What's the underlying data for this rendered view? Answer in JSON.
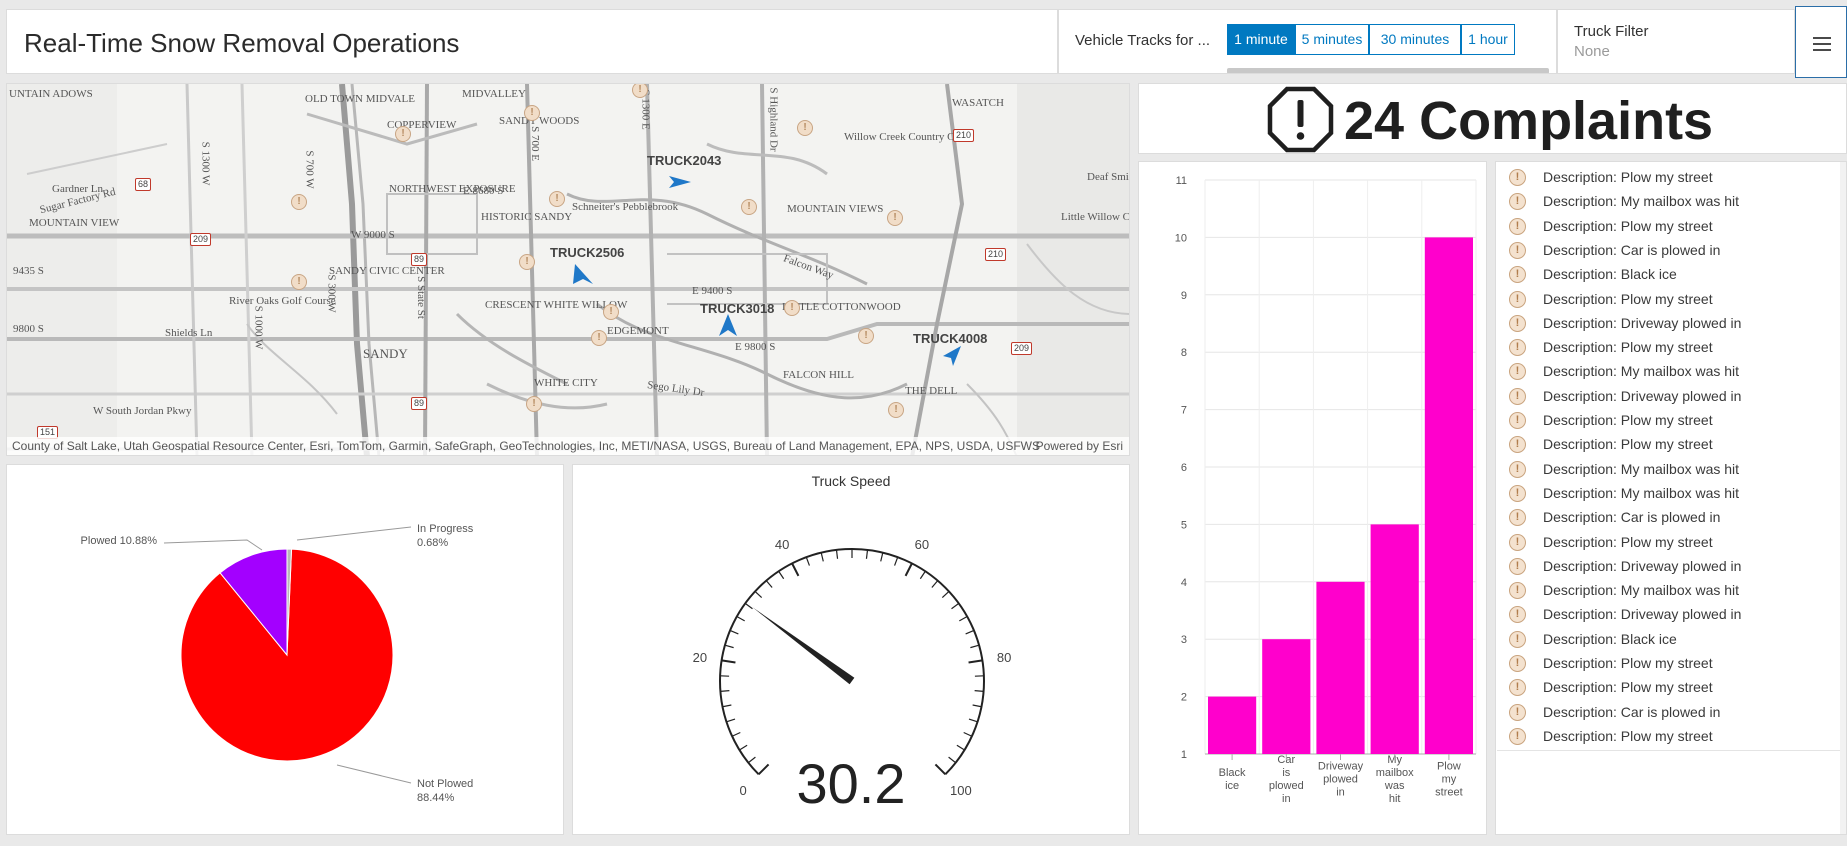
{
  "header": {
    "title": "Real-Time Snow Removal Operations",
    "tracks_label": "Vehicle Tracks for ...",
    "track_options": [
      "1 minute",
      "5 minutes",
      "30 minutes",
      "1 hour"
    ],
    "selected_track": "1 minute",
    "truck_filter_label": "Truck Filter",
    "truck_filter_value": "None",
    "menu_icon": "hamburger-menu-icon"
  },
  "map": {
    "attribution": "County of Salt Lake, Utah Geospatial Resource Center, Esri, TomTom, Garmin, SafeGraph, GeoTechnologies, Inc, METI/NASA, USGS, Bureau of Land Management, EPA, NPS, USDA, USFWS",
    "powered_by": "Powered by Esri",
    "trucks": [
      "TRUCK2043",
      "TRUCK2506",
      "TRUCK3018",
      "TRUCK4008"
    ],
    "place_labels": [
      "UNTAIN ADOWS",
      "OLD TOWN MIDVALE",
      "MIDVALLEY",
      "COPPERVIEW",
      "SANDY WOODS",
      "WASATCH",
      "Sugar Factory Rd",
      "Gardner Ln",
      "NORTHWEST EXPOSURE",
      "E 8680 S",
      "Schneiter's Pebblebrook",
      "Willow Creek Country Club",
      "Deaf Smi",
      "MOUNTAIN VIEW",
      "HISTORIC SANDY",
      "MOUNTAIN VIEWS",
      "Little Willow C",
      "W 9000 S",
      "SANDY CIVIC CENTER",
      "Falcon Way",
      "9435 S",
      "River Oaks Golf Course",
      "CRESCENT WHITE WILLOW",
      "E 9400 S",
      "LITTLE COTTONWOOD",
      "9800 S",
      "EDGEMONT",
      "E 9800 S",
      "Shields Ln",
      "SANDY",
      "FALCON HILL",
      "WHITE CITY",
      "Sego Lily Dr",
      "THE DELL",
      "W South Jordan Pkwy",
      "S 1300 W",
      "S 700 W",
      "S 1000 W",
      "S 300 W",
      "S State St",
      "S 700 E",
      "S 1300 E",
      "S Highland Dr"
    ],
    "shields": [
      "68",
      "209",
      "89",
      "210",
      "210",
      "89",
      "209",
      "151"
    ]
  },
  "indicator": {
    "icon": "alert-octagon-icon",
    "text": "24 Complaints"
  },
  "bar_chart": {
    "y_ticks": [
      "1",
      "2",
      "3",
      "4",
      "5",
      "6",
      "7",
      "8",
      "9",
      "10",
      "11"
    ],
    "x_labels": [
      [
        "Black",
        "ice"
      ],
      [
        "Car",
        "is",
        "plowed",
        "in"
      ],
      [
        "Driveway",
        "plowed",
        "in"
      ],
      [
        "My",
        "mailbox",
        "was",
        "hit"
      ],
      [
        "Plow",
        "my",
        "street"
      ]
    ],
    "bar_color": "#ff00cc"
  },
  "chart_data": [
    {
      "type": "bar",
      "categories": [
        "Black ice",
        "Car is plowed in",
        "Driveway plowed in",
        "My mailbox was hit",
        "Plow my street"
      ],
      "values": [
        2,
        3,
        4,
        5,
        10
      ],
      "title": "",
      "xlabel": "",
      "ylabel": "",
      "ylim": [
        1,
        11
      ],
      "grid": true
    },
    {
      "type": "pie",
      "categories": [
        "Not Plowed",
        "Plowed",
        "In Progress"
      ],
      "values": [
        88.44,
        10.88,
        0.68
      ],
      "labels": [
        "Not Plowed 88.44%",
        "Plowed 10.88%",
        "In Progress 0.68%"
      ],
      "colors": [
        "#ff0000",
        "#a300ff",
        "#b8b8b8"
      ]
    }
  ],
  "pie": {
    "label_plowed": "Plowed 10.88%",
    "label_in_progress_1": "In Progress",
    "label_in_progress_2": "0.68%",
    "label_not_plowed_1": "Not Plowed",
    "label_not_plowed_2": "88.44%"
  },
  "gauge": {
    "title": "Truck Speed",
    "value": 30.2,
    "value_text": "30.2",
    "min": 0,
    "max": 100,
    "tick_labels": [
      "0",
      "20",
      "40",
      "60",
      "80",
      "100"
    ]
  },
  "complaints_list": {
    "item_icon": "alert-circle-icon",
    "items": [
      "Description: Plow my street",
      "Description: My mailbox was hit",
      "Description: Plow my street",
      "Description: Car is plowed in",
      "Description: Black ice",
      "Description: Plow my street",
      "Description: Driveway plowed in",
      "Description: Plow my street",
      "Description: My mailbox was hit",
      "Description: Driveway plowed in",
      "Description: Plow my street",
      "Description: Plow my street",
      "Description: My mailbox was hit",
      "Description: My mailbox was hit",
      "Description: Car is plowed in",
      "Description: Plow my street",
      "Description: Driveway plowed in",
      "Description: My mailbox was hit",
      "Description: Driveway plowed in",
      "Description: Black ice",
      "Description: Plow my street",
      "Description: Plow my street",
      "Description: Car is plowed in",
      "Description: Plow my street"
    ]
  }
}
